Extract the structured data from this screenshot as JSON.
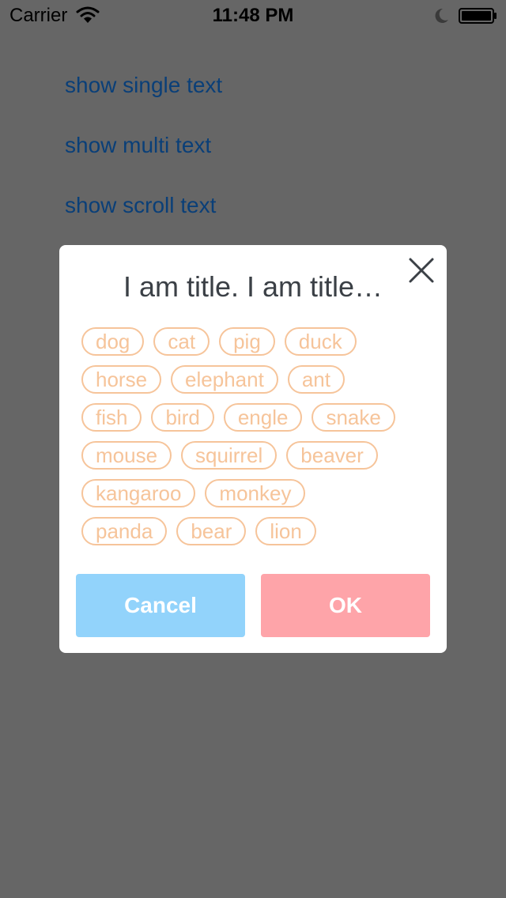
{
  "status_bar": {
    "carrier": "Carrier",
    "time": "11:48 PM",
    "icons": [
      "wifi-icon",
      "moon-icon",
      "battery-icon"
    ]
  },
  "menu": {
    "items": [
      {
        "label": "show single text"
      },
      {
        "label": "show multi text"
      },
      {
        "label": "show scroll text"
      }
    ]
  },
  "dialog": {
    "title": "I am title.  I am title…",
    "close_icon": "close-icon",
    "tag_rows": [
      [
        "dog",
        "cat",
        "pig",
        "duck"
      ],
      [
        "horse",
        "elephant",
        "ant"
      ],
      [
        "fish",
        "bird",
        "engle",
        "snake"
      ],
      [
        "mouse",
        "squirrel",
        "beaver"
      ],
      [
        "kangaroo",
        "monkey"
      ],
      [
        "panda",
        "bear",
        "lion"
      ]
    ],
    "cancel_label": "Cancel",
    "ok_label": "OK"
  },
  "colors": {
    "overlay": "#666666",
    "link": "#0a3f78",
    "tag": "#f6c49a",
    "cancel": "#92d3fb",
    "ok": "#fea4a9",
    "title": "#3b4046"
  }
}
